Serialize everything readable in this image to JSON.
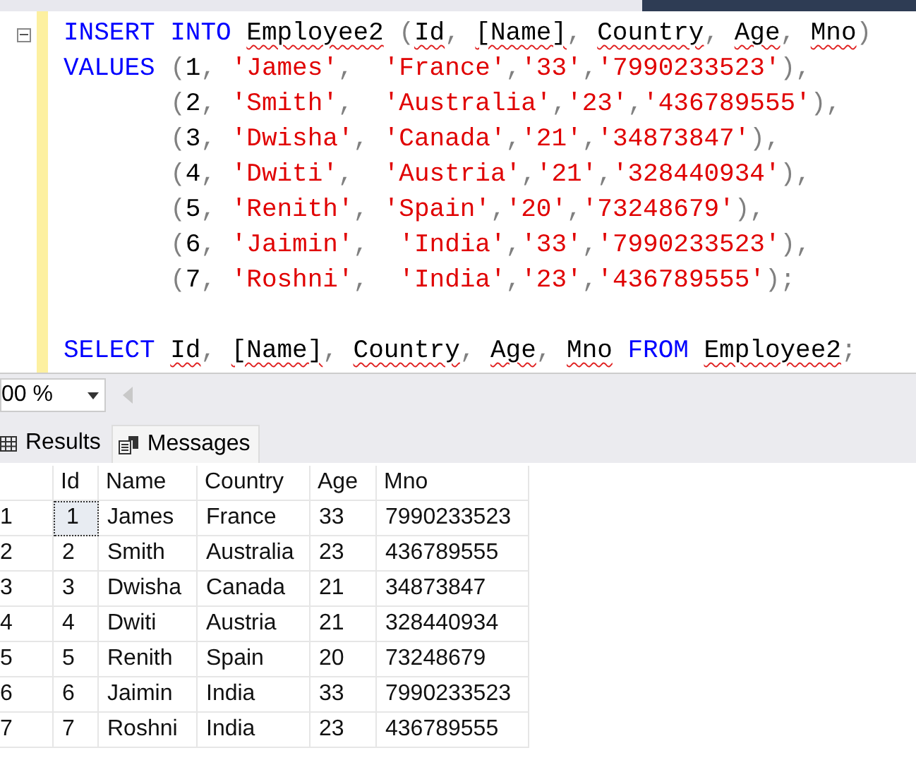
{
  "editor": {
    "statements": [
      {
        "lines": [
          {
            "tokens": [
              {
                "keyword": "INSERT "
              },
              {
                "keyword": "INTO "
              },
              {
                "flagged": "Employee2"
              },
              {
                "punct": " ("
              },
              {
                "flagged": "Id"
              },
              {
                "punct": ", "
              },
              {
                "flagged": "[Name]"
              },
              {
                "punct": ", "
              },
              {
                "flagged": "Country"
              },
              {
                "punct": ", "
              },
              {
                "flagged": "Age"
              },
              {
                "punct": ", "
              },
              {
                "flagged": "Mno"
              },
              {
                "punct": ")"
              }
            ]
          },
          {
            "tokens": [
              {
                "keyword": "VALUES"
              },
              {
                "punct": " ("
              },
              {
                "plain": "1"
              },
              {
                "punct": ", "
              },
              {
                "string": "'James'"
              },
              {
                "punct": ",  "
              },
              {
                "string": "'France'"
              },
              {
                "punct": ","
              },
              {
                "string": "'33'"
              },
              {
                "punct": ","
              },
              {
                "string": "'7990233523'"
              },
              {
                "punct": "),"
              }
            ]
          },
          {
            "tokens": [
              {
                "punct": "       ("
              },
              {
                "plain": "2"
              },
              {
                "punct": ", "
              },
              {
                "string": "'Smith'"
              },
              {
                "punct": ",  "
              },
              {
                "string": "'Australia'"
              },
              {
                "punct": ","
              },
              {
                "string": "'23'"
              },
              {
                "punct": ","
              },
              {
                "string": "'436789555'"
              },
              {
                "punct": "),"
              }
            ]
          },
          {
            "tokens": [
              {
                "punct": "       ("
              },
              {
                "plain": "3"
              },
              {
                "punct": ", "
              },
              {
                "string": "'Dwisha'"
              },
              {
                "punct": ", "
              },
              {
                "string": "'Canada'"
              },
              {
                "punct": ","
              },
              {
                "string": "'21'"
              },
              {
                "punct": ","
              },
              {
                "string": "'34873847'"
              },
              {
                "punct": "),"
              }
            ]
          },
          {
            "tokens": [
              {
                "punct": "       ("
              },
              {
                "plain": "4"
              },
              {
                "punct": ", "
              },
              {
                "string": "'Dwiti'"
              },
              {
                "punct": ",  "
              },
              {
                "string": "'Austria'"
              },
              {
                "punct": ","
              },
              {
                "string": "'21'"
              },
              {
                "punct": ","
              },
              {
                "string": "'328440934'"
              },
              {
                "punct": "),"
              }
            ]
          },
          {
            "tokens": [
              {
                "punct": "       ("
              },
              {
                "plain": "5"
              },
              {
                "punct": ", "
              },
              {
                "string": "'Renith'"
              },
              {
                "punct": ", "
              },
              {
                "string": "'Spain'"
              },
              {
                "punct": ","
              },
              {
                "string": "'20'"
              },
              {
                "punct": ","
              },
              {
                "string": "'73248679'"
              },
              {
                "punct": "),"
              }
            ]
          },
          {
            "tokens": [
              {
                "punct": "       ("
              },
              {
                "plain": "6"
              },
              {
                "punct": ", "
              },
              {
                "string": "'Jaimin'"
              },
              {
                "punct": ",  "
              },
              {
                "string": "'India'"
              },
              {
                "punct": ","
              },
              {
                "string": "'33'"
              },
              {
                "punct": ","
              },
              {
                "string": "'7990233523'"
              },
              {
                "punct": "),"
              }
            ]
          },
          {
            "tokens": [
              {
                "punct": "       ("
              },
              {
                "plain": "7"
              },
              {
                "punct": ", "
              },
              {
                "string": "'Roshni'"
              },
              {
                "punct": ",  "
              },
              {
                "string": "'India'"
              },
              {
                "punct": ","
              },
              {
                "string": "'23'"
              },
              {
                "punct": ","
              },
              {
                "string": "'436789555'"
              },
              {
                "punct": ");"
              }
            ]
          }
        ]
      },
      {
        "lines": [
          {
            "tokens": [
              {
                "keyword": "SELECT "
              },
              {
                "flagged": "Id"
              },
              {
                "punct": ", "
              },
              {
                "flagged": "[Name]"
              },
              {
                "punct": ", "
              },
              {
                "flagged": "Country"
              },
              {
                "punct": ", "
              },
              {
                "flagged": "Age"
              },
              {
                "punct": ", "
              },
              {
                "flagged": "Mno"
              },
              {
                "keyword": " FROM "
              },
              {
                "flagged": "Employee2"
              },
              {
                "punct": ";"
              }
            ]
          }
        ]
      }
    ]
  },
  "zoom": {
    "value": "00 %"
  },
  "result_tabs": [
    {
      "label": "Results",
      "kind": "grid",
      "selected": true
    },
    {
      "label": "Messages",
      "kind": "messages",
      "selected": false
    }
  ],
  "grid": {
    "columns": [
      "Id",
      "Name",
      "Country",
      "Age",
      "Mno"
    ],
    "rows": [
      {
        "number": "1",
        "selected": true,
        "cells": [
          "1",
          "James",
          "France",
          "33",
          "7990233523"
        ]
      },
      {
        "number": "2",
        "selected": false,
        "cells": [
          "2",
          "Smith",
          "Australia",
          "23",
          "436789555"
        ]
      },
      {
        "number": "3",
        "selected": false,
        "cells": [
          "3",
          "Dwisha",
          "Canada",
          "21",
          "34873847"
        ]
      },
      {
        "number": "4",
        "selected": false,
        "cells": [
          "4",
          "Dwiti",
          "Austria",
          "21",
          "328440934"
        ]
      },
      {
        "number": "5",
        "selected": false,
        "cells": [
          "5",
          "Renith",
          "Spain",
          "20",
          "73248679"
        ]
      },
      {
        "number": "6",
        "selected": false,
        "cells": [
          "6",
          "Jaimin",
          "India",
          "33",
          "7990233523"
        ]
      },
      {
        "number": "7",
        "selected": false,
        "cells": [
          "7",
          "Roshni",
          "India",
          "23",
          "436789555"
        ]
      }
    ]
  }
}
